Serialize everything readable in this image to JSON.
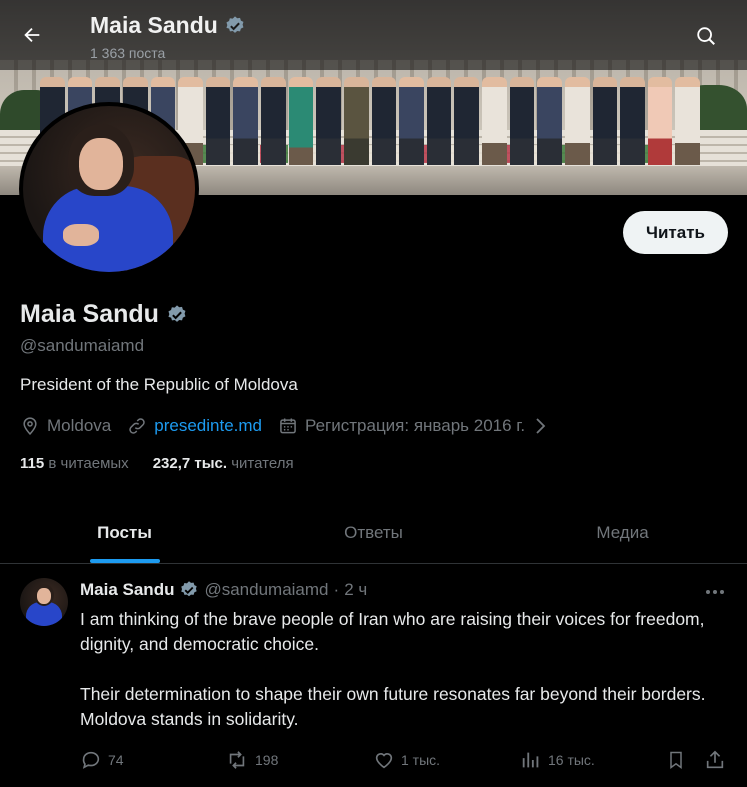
{
  "header": {
    "name": "Maia Sandu",
    "posts_count": "1 363 поста"
  },
  "profile": {
    "name": "Maia Sandu",
    "handle": "@sandumaiamd",
    "bio": "President of the Republic of Moldova",
    "location": "Moldova",
    "website": "presedinte.md",
    "joined": "Регистрация: январь 2016 г.",
    "following_count": "115",
    "following_label": "в читаемых",
    "followers_count": "232,7 тыс.",
    "followers_label": "читателя",
    "follow_button": "Читать"
  },
  "tabs": [
    {
      "label": "Посты",
      "active": true
    },
    {
      "label": "Ответы",
      "active": false
    },
    {
      "label": "Медиа",
      "active": false
    }
  ],
  "tweet": {
    "name": "Maia Sandu",
    "handle": "@sandumaiamd",
    "separator": "·",
    "time": "2 ч",
    "paragraphs": [
      "I am thinking of the brave people of Iran who are raising their voices for freedom, dignity, and democratic choice.",
      "Their determination to shape their own future resonates far beyond their borders. Moldova stands in solidarity."
    ],
    "replies": "74",
    "reposts": "198",
    "likes": "1 тыс.",
    "views": "16 тыс."
  },
  "colors": {
    "background": "#000000",
    "accent": "#1d9bf0",
    "verified": "#829aab",
    "muted_text": "#71767b",
    "primary_text": "#e7e9ea"
  },
  "icons": [
    "back-arrow-icon",
    "search-icon",
    "verified-badge-icon",
    "location-icon",
    "link-icon",
    "calendar-icon",
    "chevron-right-icon",
    "more-icon",
    "reply-icon",
    "repost-icon",
    "like-icon",
    "views-icon",
    "bookmark-icon",
    "share-icon"
  ]
}
